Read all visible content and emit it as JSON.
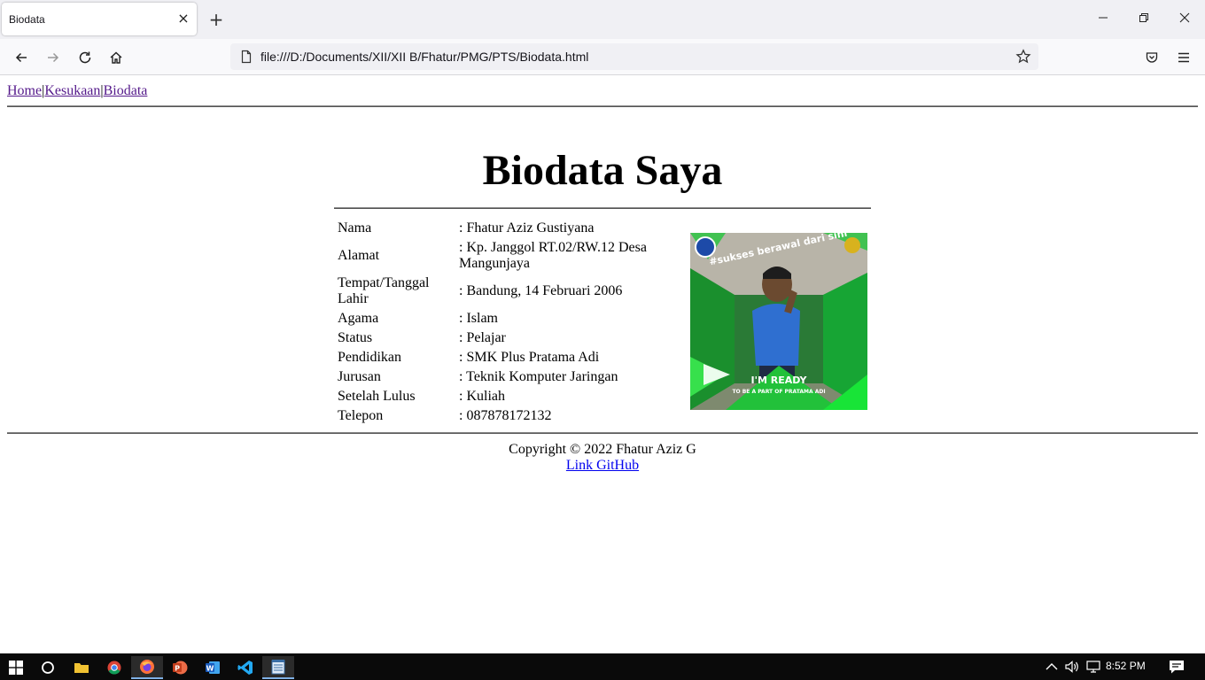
{
  "browser": {
    "tab_title": "Biodata",
    "tab_close": "×",
    "new_tab": "+",
    "url": "file:///D:/Documents/XII/XII B/Fhatur/PMG/PTS/Biodata.html"
  },
  "page": {
    "nav": [
      {
        "label": "Home"
      },
      {
        "label": "Kesukaan"
      },
      {
        "label": "Biodata"
      }
    ],
    "nav_separator": "|",
    "heading": "Biodata Saya",
    "rows": [
      {
        "label": "Nama",
        "value": ": Fhatur Aziz Gustiyana"
      },
      {
        "label": "Alamat",
        "value": ": Kp. Janggol RT.02/RW.12 Desa Mangunjaya"
      },
      {
        "label": "Tempat/Tanggal Lahir",
        "value": ": Bandung, 14 Februari 2006"
      },
      {
        "label": "Agama",
        "value": ": Islam"
      },
      {
        "label": "Status",
        "value": ": Pelajar"
      },
      {
        "label": "Pendidikan",
        "value": ": SMK Plus Pratama Adi"
      },
      {
        "label": "Jurusan",
        "value": ": Teknik Komputer Jaringan"
      },
      {
        "label": "Setelah Lulus",
        "value": ": Kuliah"
      },
      {
        "label": "Telepon",
        "value": ": 087878172132"
      }
    ],
    "photo": {
      "text_top": "#sukses berawal dari sini",
      "text_ready": "I'M READY",
      "text_sub": "TO BE A PART OF PRATAMA ADI"
    },
    "footer": {
      "copyright": "Copyright © 2022 Fhatur Aziz G",
      "link": "Link GitHub"
    }
  },
  "taskbar": {
    "clock": "8:52 PM"
  },
  "colors": {
    "visited_link": "#551a8b",
    "link": "#0000ee",
    "photo_green": "#1fb53a",
    "photo_shirt": "#2f6fd0"
  }
}
